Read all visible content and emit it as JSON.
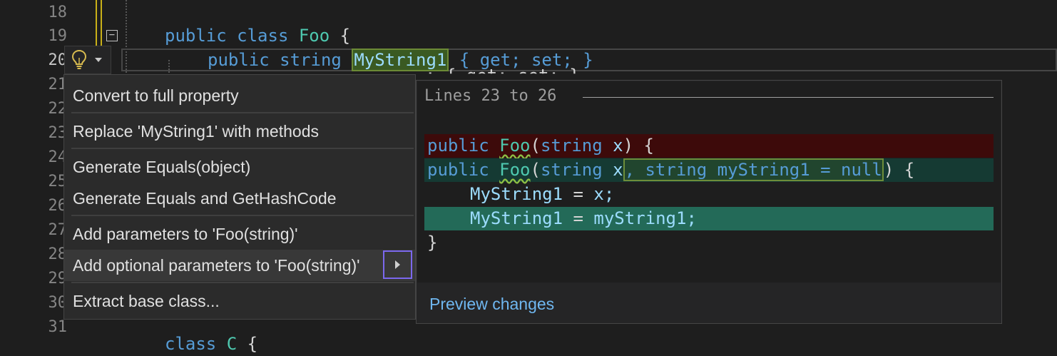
{
  "editor": {
    "line_numbers": [
      "18",
      "19",
      "20",
      "21",
      "22",
      "23",
      "24",
      "25",
      "26",
      "27",
      "28",
      "29",
      "30",
      "31"
    ],
    "line19": {
      "kw1": "public",
      "kw2": "class",
      "type": "Foo",
      "brace": "{"
    },
    "line20": {
      "kw1": "public",
      "kw2": "string",
      "prop": "MyString1",
      "rest": "{ get; set; }"
    },
    "line21_fragment": "; { get; set; }",
    "line32_kw": "class",
    "line32_type": "C",
    "line32_brace": "{"
  },
  "lightbulb": {
    "icon": "lightbulb-icon"
  },
  "menu": {
    "items": [
      "Convert to full property",
      "Replace 'MyString1' with methods",
      "Generate Equals(object)",
      "Generate Equals and GetHashCode",
      "Add parameters to 'Foo(string)'",
      "Add optional parameters to 'Foo(string)'",
      "Extract base class..."
    ],
    "selected_index": 5
  },
  "preview": {
    "title": "Lines 23 to 26",
    "removed_line": {
      "kw": "public",
      "type": "Foo",
      "paren": "(",
      "ptype": "string",
      "pname": "x",
      "close": ") {"
    },
    "added_line": {
      "kw": "public",
      "type": "Foo",
      "paren": "(",
      "ptype": "string",
      "pname": "x",
      "added": ", string myString1 = null",
      "close": ") {"
    },
    "body1": {
      "lhs": "MyString1",
      "op": " = ",
      "rhs": "x;"
    },
    "body2": {
      "lhs": "MyString1",
      "op": " = ",
      "rhs": "myString1;"
    },
    "closing": "}",
    "link": "Preview changes"
  },
  "colors": {
    "keyword": "#569cd6",
    "type": "#4ec9b0",
    "identifier": "#9cdcfe",
    "removed_bg": "#3d0a0a",
    "added_bg": "#153a33",
    "link": "#6fb7f0",
    "submenu_focus": "#7b68ee"
  }
}
